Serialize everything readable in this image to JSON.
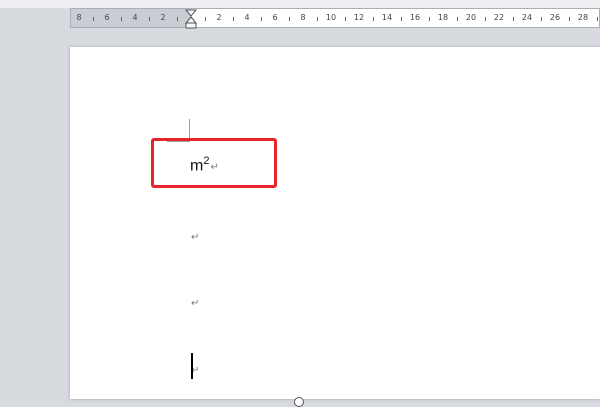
{
  "ruler": {
    "left_numbers": [
      "8",
      "6",
      "4",
      "2"
    ],
    "right_numbers": [
      "2",
      "4",
      "6",
      "8",
      "10",
      "12",
      "14",
      "16",
      "18",
      "20",
      "22",
      "24",
      "26",
      "28"
    ]
  },
  "document": {
    "line1": {
      "base": "m",
      "superscript": "2",
      "mark": "↵"
    },
    "empty_lines": [
      {
        "mark": "↵"
      },
      {
        "mark": "↵"
      },
      {
        "mark": "↵"
      }
    ]
  },
  "colors": {
    "highlight_border": "#e8232c",
    "background": "#d7dbe0",
    "page": "#ffffff"
  }
}
